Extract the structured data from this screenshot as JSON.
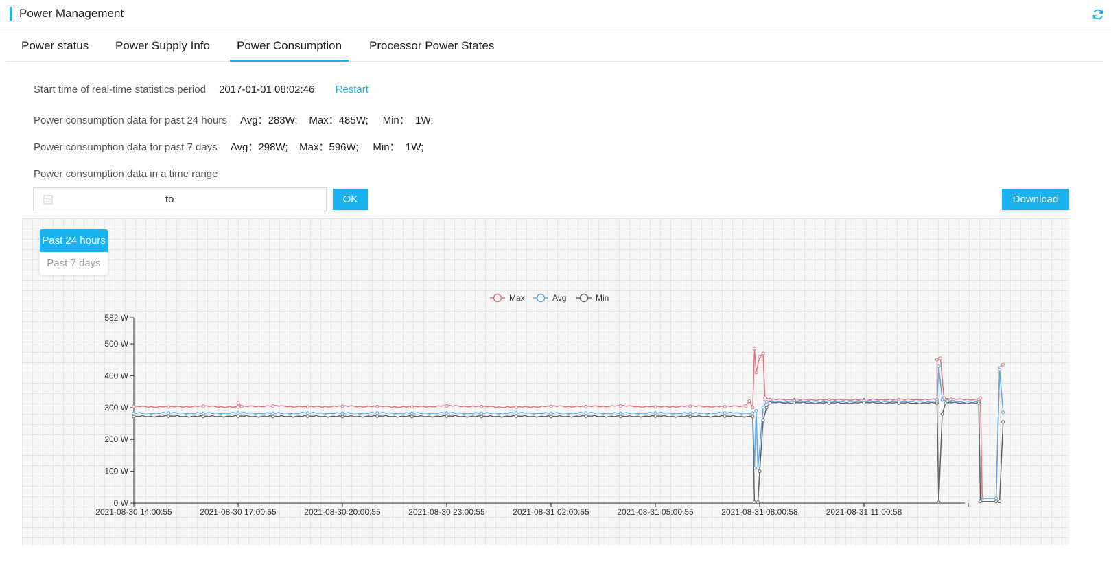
{
  "header": {
    "title": "Power Management",
    "accent_color": "#1ab3f0",
    "refresh_icon": "refresh-icon"
  },
  "tabs": [
    {
      "label": "Power status",
      "active": false
    },
    {
      "label": "Power Supply Info",
      "active": false
    },
    {
      "label": "Power Consumption",
      "active": true
    },
    {
      "label": "Processor Power States",
      "active": false
    }
  ],
  "stats": {
    "start_label": "Start time of real-time statistics period",
    "start_value": "2017-01-01 08:02:46",
    "restart_label": "Restart",
    "past24_label": "Power consumption data for past 24 hours",
    "past24_values": "Avg：283W;    Max：485W;     Min：  1W;",
    "past7_label": "Power consumption data for past 7 days",
    "past7_values": "Avg：298W;    Max：596W;     Min：  1W;",
    "range_label": "Power consumption data in a time range"
  },
  "range": {
    "to_label": "to",
    "start_value": "",
    "end_value": "",
    "ok_label": "OK",
    "download_label": "Download"
  },
  "period_toggle": {
    "past24": "Past 24 hours",
    "past7": "Past 7 days",
    "selected": "Past 24 hours"
  },
  "chart_data": {
    "type": "line",
    "title": "",
    "xlabel": "",
    "ylabel": "",
    "ylim": [
      0,
      582
    ],
    "y_ticks": [
      {
        "value": 0,
        "label": "0 W"
      },
      {
        "value": 100,
        "label": "100 W"
      },
      {
        "value": 200,
        "label": "200 W"
      },
      {
        "value": 300,
        "label": "300 W"
      },
      {
        "value": 400,
        "label": "400 W"
      },
      {
        "value": 500,
        "label": "500 W"
      },
      {
        "value": 582,
        "label": "582 W"
      }
    ],
    "x_ticks": [
      "2021-08-30 14:00:55",
      "2021-08-30 17:00:55",
      "2021-08-30 20:00:55",
      "2021-08-30 23:00:55",
      "2021-08-31 02:00:55",
      "2021-08-31 05:00:55",
      "2021-08-31 08:00:58",
      "2021-08-31 11:00:58"
    ],
    "x_range_hours": [
      0,
      24
    ],
    "legend_position": "top-center",
    "series": [
      {
        "name": "Max",
        "color": "#d9777f",
        "points": [
          [
            0,
            303
          ],
          [
            1,
            302
          ],
          [
            2,
            304
          ],
          [
            3,
            301
          ],
          [
            3,
            315
          ],
          [
            3.1,
            303
          ],
          [
            4,
            305
          ],
          [
            5,
            302
          ],
          [
            6,
            304
          ],
          [
            7,
            303
          ],
          [
            8,
            302
          ],
          [
            9,
            305
          ],
          [
            10,
            303
          ],
          [
            11,
            301
          ],
          [
            12,
            304
          ],
          [
            13,
            303
          ],
          [
            14,
            305
          ],
          [
            15,
            302
          ],
          [
            16,
            304
          ],
          [
            17,
            303
          ],
          [
            17.6,
            305
          ],
          [
            17.7,
            320
          ],
          [
            17.8,
            300
          ],
          [
            17.85,
            485
          ],
          [
            17.9,
            410
          ],
          [
            18.0,
            460
          ],
          [
            18.1,
            470
          ],
          [
            18.15,
            330
          ],
          [
            18.3,
            325
          ],
          [
            19,
            325
          ],
          [
            20,
            324
          ],
          [
            21,
            325
          ],
          [
            22,
            325
          ],
          [
            23.1,
            325
          ],
          [
            23.1,
            450
          ],
          [
            23.2,
            455
          ],
          [
            23.3,
            330
          ],
          [
            23.5,
            326
          ],
          [
            24.3,
            325
          ],
          [
            24.35,
            330
          ],
          [
            24.4,
            15
          ],
          [
            24.8,
            15
          ],
          [
            24.9,
            425
          ],
          [
            25.0,
            435
          ]
        ]
      },
      {
        "name": "Avg",
        "color": "#62a8e0",
        "points": [
          [
            0,
            282
          ],
          [
            1,
            283
          ],
          [
            2,
            282
          ],
          [
            3,
            283
          ],
          [
            4,
            282
          ],
          [
            5,
            283
          ],
          [
            6,
            282
          ],
          [
            7,
            283
          ],
          [
            8,
            282
          ],
          [
            9,
            283
          ],
          [
            10,
            282
          ],
          [
            11,
            283
          ],
          [
            12,
            282
          ],
          [
            13,
            283
          ],
          [
            14,
            282
          ],
          [
            15,
            283
          ],
          [
            16,
            282
          ],
          [
            17,
            283
          ],
          [
            17.8,
            283
          ],
          [
            17.85,
            110
          ],
          [
            17.9,
            290
          ],
          [
            17.95,
            110
          ],
          [
            18.1,
            300
          ],
          [
            18.2,
            318
          ],
          [
            19,
            320
          ],
          [
            20,
            318
          ],
          [
            21,
            320
          ],
          [
            22,
            319
          ],
          [
            23.1,
            318
          ],
          [
            23.15,
            430
          ],
          [
            23.25,
            325
          ],
          [
            23.4,
            320
          ],
          [
            24.3,
            318
          ],
          [
            24.35,
            15
          ],
          [
            24.8,
            15
          ],
          [
            24.9,
            420
          ],
          [
            25.0,
            285
          ]
        ]
      },
      {
        "name": "Min",
        "color": "#666666",
        "points": [
          [
            0,
            272
          ],
          [
            1,
            273
          ],
          [
            2,
            272
          ],
          [
            3,
            273
          ],
          [
            4,
            272
          ],
          [
            5,
            273
          ],
          [
            6,
            272
          ],
          [
            7,
            273
          ],
          [
            8,
            272
          ],
          [
            9,
            273
          ],
          [
            10,
            272
          ],
          [
            11,
            273
          ],
          [
            12,
            272
          ],
          [
            13,
            273
          ],
          [
            14,
            272
          ],
          [
            15,
            273
          ],
          [
            16,
            272
          ],
          [
            17,
            273
          ],
          [
            17.8,
            272
          ],
          [
            17.85,
            3
          ],
          [
            17.95,
            3
          ],
          [
            18.0,
            100
          ],
          [
            18.1,
            260
          ],
          [
            18.2,
            300
          ],
          [
            18.3,
            315
          ],
          [
            19,
            315
          ],
          [
            20,
            314
          ],
          [
            21,
            315
          ],
          [
            22,
            314
          ],
          [
            23.1,
            314
          ],
          [
            23.15,
            3
          ],
          [
            23.25,
            280
          ],
          [
            23.35,
            315
          ],
          [
            24.3,
            314
          ],
          [
            24.35,
            5
          ],
          [
            24.8,
            5
          ],
          [
            24.9,
            5
          ],
          [
            25.0,
            255
          ]
        ]
      }
    ]
  }
}
